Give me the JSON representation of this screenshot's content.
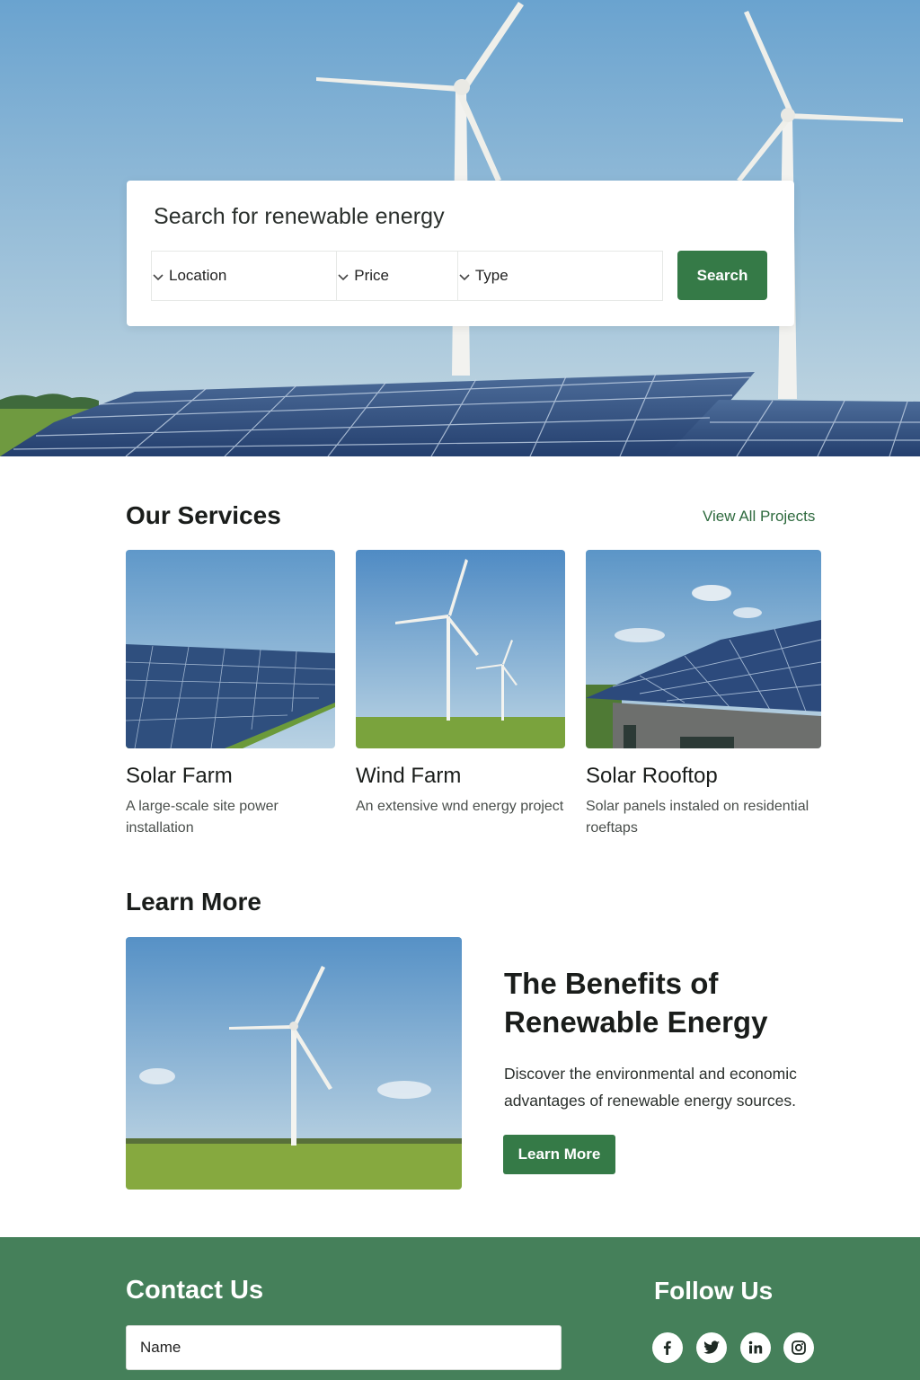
{
  "search": {
    "title": "Search for renewable energy",
    "filters": {
      "location": "Location",
      "price": "Price",
      "type": "Type"
    },
    "button_label": "Search"
  },
  "services": {
    "title": "Our Services",
    "view_all": "View All Projects",
    "cards": [
      {
        "title": "Solar Farm",
        "description": "A large-scale site power installation"
      },
      {
        "title": "Wind Farm",
        "description": "An extensive wnd energy project"
      },
      {
        "title": "Solar Rooftop",
        "description": "Solar panels instaled on residential roeftaps"
      }
    ]
  },
  "learn_more": {
    "section_title": "Learn More",
    "article_title": "The Benefits of Renewable Energy",
    "description": "Discover the environmental and economic advantages of renewable energy sources.",
    "button_label": "Learn More"
  },
  "footer": {
    "contact_title": "Contact Us",
    "name_placeholder": "Name",
    "follow_title": "Follow Us",
    "social_icons": [
      "facebook-icon",
      "twitter-icon",
      "linkedin-icon",
      "instagram-icon"
    ]
  },
  "colors": {
    "primary_green": "#357a47",
    "footer_green": "#45805a",
    "link_green": "#2e6a3e"
  }
}
